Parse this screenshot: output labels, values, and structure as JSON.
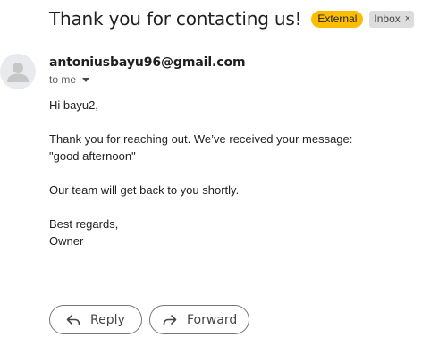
{
  "email": {
    "subject": "Thank you for contacting us!",
    "labels": {
      "external": "External",
      "inbox": "Inbox",
      "inbox_remove": "×"
    },
    "sender": "antoniusbayu96@gmail.com",
    "recipient": "to me",
    "body": {
      "greeting": "Hi bayu2,",
      "line1": "Thank you for reaching out. We’ve received your message:",
      "line2": "\"good afternoon\"",
      "line3": "Our team will get back to you shortly.",
      "closing": "Best regards,",
      "signature": "Owner"
    }
  },
  "actions": {
    "reply_label": "Reply",
    "forward_label": "Forward"
  },
  "colors": {
    "external_label": "#fbbc04",
    "inbox_label": "#dddddd",
    "button_border": "#747775"
  },
  "icons": {
    "avatar": "person-icon",
    "recipient_toggle": "caret-down-icon",
    "reply": "reply-arrow-icon",
    "forward": "forward-arrow-icon"
  }
}
